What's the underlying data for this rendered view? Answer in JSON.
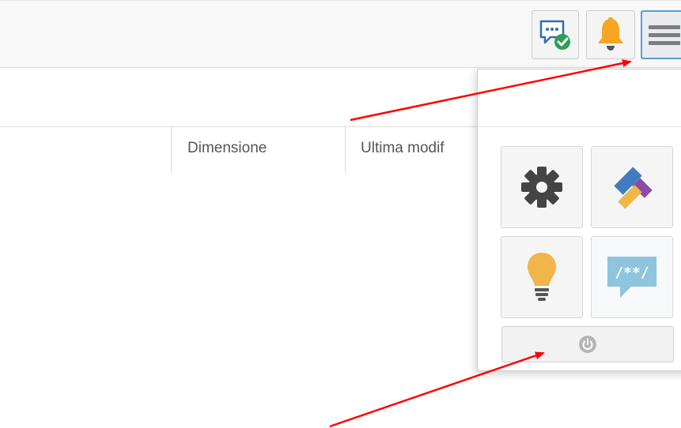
{
  "table": {
    "columns": [
      {
        "label": "Dimensione"
      },
      {
        "label": "Ultima modif"
      }
    ]
  },
  "toolbar": {
    "chat_icon": "chat-check-icon",
    "notifications_icon": "bell-icon",
    "menu_icon": "hamburger-menu-icon"
  },
  "menu": {
    "tiles": [
      {
        "icon": "gear-icon"
      },
      {
        "icon": "colored-blocks-icon"
      },
      {
        "icon": "lightbulb-icon"
      },
      {
        "icon": "code-comment-icon",
        "text": "/**/"
      }
    ],
    "logout_icon": "power-icon"
  },
  "colors": {
    "accent_blue": "#5b9bd5",
    "bell_orange": "#f5a623",
    "bulb_yellow": "#f0b64a",
    "annotation_red": "#ff0000",
    "comment_bubble": "#8ec5dd"
  }
}
